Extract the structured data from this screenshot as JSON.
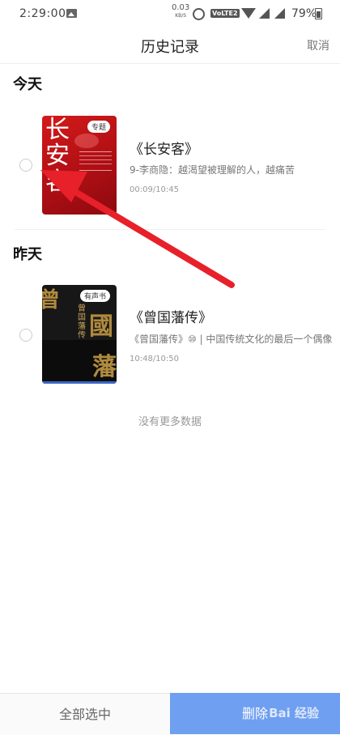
{
  "status_bar": {
    "time": "2:29:00",
    "net_speed_value": "0.03",
    "net_speed_unit": "KB/S",
    "volte": "VoLTE2",
    "battery": "79%",
    "icons": [
      "photo-icon",
      "alarm-icon",
      "wifi-icon",
      "signal-icon",
      "battery-icon"
    ]
  },
  "header": {
    "title": "历史记录",
    "cancel_label": "取消"
  },
  "sections": [
    {
      "heading": "今天",
      "items": [
        {
          "cover_title": "长安客",
          "badge": "专题",
          "title": "《长安客》",
          "subtitle": "9-李商隐：越渴望被理解的人，越痛苦",
          "progress": "00:09/10:45"
        }
      ]
    },
    {
      "heading": "昨天",
      "items": [
        {
          "cover_title": "曾国藩传",
          "badge": "有声书",
          "title": "《曾国藩传》",
          "subtitle": "《曾国藩传》⑩ | 中国传统文化的最后一个偶像",
          "progress": "10:48/10:50"
        }
      ]
    }
  ],
  "footer_note": "没有更多数据",
  "bottom_bar": {
    "select_all_label": "全部选中",
    "delete_label": "删除",
    "watermark": "Bai 经验"
  },
  "colors": {
    "accent": "#6f9ff0",
    "arrow": "#e8202a",
    "cover_red": "#c8161c",
    "cover_dark": "#171717"
  }
}
